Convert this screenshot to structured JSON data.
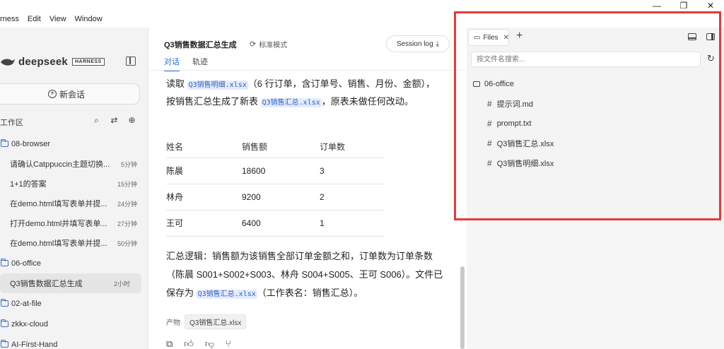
{
  "window": {
    "minimize_glyph": "—",
    "restore_glyph": "❐",
    "close_glyph": "✕"
  },
  "menu": [
    "rness",
    "Edit",
    "View",
    "Window"
  ],
  "sidebar": {
    "brand": "deepseek",
    "badge": "HARNESS",
    "new_chat_label": "新会话",
    "workspace_label": "工作区",
    "workspace_icons": [
      "search-icon",
      "filter-icon",
      "new-folder-icon"
    ],
    "tree": [
      {
        "type": "folder",
        "title": "08-browser"
      },
      {
        "type": "chat",
        "title": "请确认Catppuccin主题切换...",
        "time": "5分钟"
      },
      {
        "type": "chat",
        "title": "1+1的答案",
        "time": "15分钟"
      },
      {
        "type": "chat",
        "title": "在demo.html填写表单并提...",
        "time": "24分钟"
      },
      {
        "type": "chat",
        "title": "打开demo.html并填写表单...",
        "time": "27分钟"
      },
      {
        "type": "chat",
        "title": "在demo.html填写表单并提...",
        "time": "50分钟"
      },
      {
        "type": "folder",
        "title": "06-office"
      },
      {
        "type": "chat",
        "title": "Q3销售数据汇总生成",
        "time": "2小时",
        "active": true
      },
      {
        "type": "folder",
        "title": "02-at-file"
      },
      {
        "type": "folder",
        "title": "zkkx-cloud"
      },
      {
        "type": "folder",
        "title": "AI-First-Hand"
      }
    ]
  },
  "chat": {
    "title": "Q3销售数据汇总生成",
    "mode": "标准模式",
    "session_log": "Session log",
    "tabs": [
      "对话",
      "轨迹"
    ],
    "para1": {
      "t1": "读取 ",
      "c1": "Q3销售明细.xlsx",
      "t2": "（6 行订单，含订单号、销售、月份、金额），按销售汇总生成了新表 ",
      "c2": "Q3销售汇总.xlsx",
      "t3": "，原表未做任何改动。"
    },
    "table": {
      "headers": [
        "姓名",
        "销售额",
        "订单数"
      ],
      "rows": [
        [
          "陈晨",
          "18600",
          "3"
        ],
        [
          "林舟",
          "9200",
          "2"
        ],
        [
          "王可",
          "6400",
          "1"
        ]
      ]
    },
    "para2": {
      "t1": "汇总逻辑：销售额为该销售全部订单金额之和，订单数为订单条数（陈晨 S001+S002+S003、林舟 S004+S005、王可 S006）。文件已保存为 ",
      "c1": "Q3销售汇总.xlsx",
      "t2": "（工作表名：销售汇总）。"
    },
    "artifact_label": "产物",
    "artifact_file": "Q3销售汇总.xlsx",
    "action_icons": [
      "copy-icon",
      "thumbs-up-icon",
      "thumbs-down-icon",
      "branch-icon"
    ]
  },
  "files_panel": {
    "tab_label": "Files",
    "search_placeholder": "按文件名搜索...",
    "folder": "06-office",
    "files": [
      "提示词.md",
      "prompt.txt",
      "Q3销售汇总.xlsx",
      "Q3销售明细.xlsx"
    ]
  },
  "colors": {
    "accent": "#2b6ae3",
    "folder_icon": "#3a6fd1",
    "highlight": "#e53a3a"
  }
}
